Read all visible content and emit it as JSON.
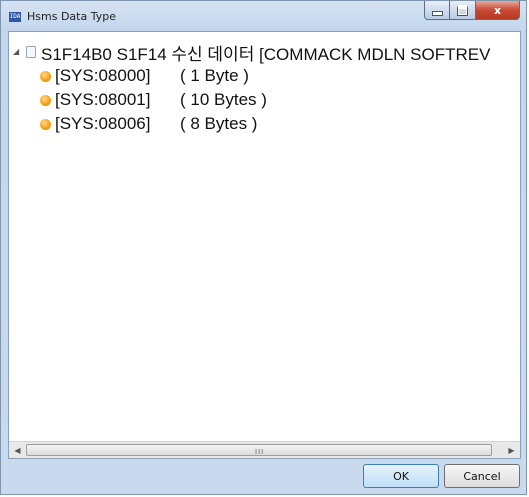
{
  "window": {
    "title": "Hsms Data Type",
    "icon_label": "IDA",
    "close_glyph": "x"
  },
  "tree": {
    "root": {
      "label": "S1F14B0 S1F14 수신 데이터 [COMMACK MDLN SOFTREV",
      "expanded": true
    },
    "items": [
      {
        "id": "[SYS:08000]",
        "size": "( 1 Byte )"
      },
      {
        "id": "[SYS:08001]",
        "size": "( 10 Bytes )"
      },
      {
        "id": "[SYS:08006]",
        "size": "( 8 Bytes )"
      }
    ]
  },
  "scrollbar": {
    "grip": "III"
  },
  "buttons": {
    "ok_label": "OK",
    "cancel_label": "Cancel"
  },
  "colors": {
    "bullet": "#f59d16",
    "close_button": "#c74a35",
    "ok_button": "#bfdff6"
  }
}
